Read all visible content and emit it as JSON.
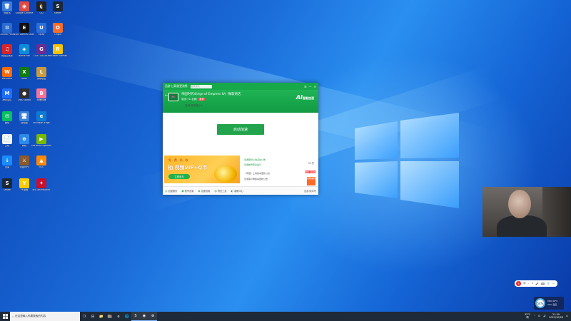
{
  "desktop": {
    "icons": [
      {
        "label": "回收站",
        "glyph": "🗑",
        "color": "#3b7dd8"
      },
      {
        "label": "Google Chrome",
        "glyph": "◉",
        "color": "#e04a3f"
      },
      {
        "label": "QQ",
        "glyph": "🐧",
        "color": "#222222"
      },
      {
        "label": "Steam",
        "glyph": "S",
        "color": "#1b2838"
      },
      {
        "label": "Control Panel",
        "glyph": "⚙",
        "color": "#2a6bd0"
      },
      {
        "label": "Epic Games Launcher",
        "glyph": "E",
        "color": "#111111"
      },
      {
        "label": "Uplay",
        "glyph": "U",
        "color": "#2a6fd6"
      },
      {
        "label": "Origin",
        "glyph": "O",
        "color": "#f56c2d"
      },
      {
        "label": "网易云音乐",
        "glyph": "♫",
        "color": "#d8232a"
      },
      {
        "label": "Battle.net",
        "glyph": "◈",
        "color": "#0d8bd8"
      },
      {
        "label": "GOG GALAXY",
        "glyph": "G",
        "color": "#6b2c91"
      },
      {
        "label": "Rockstar Games",
        "glyph": "R",
        "color": "#f6c300"
      },
      {
        "label": "WeGame",
        "glyph": "W",
        "color": "#ff6a00"
      },
      {
        "label": "Xbox",
        "glyph": "X",
        "color": "#107c10"
      },
      {
        "label": "英雄联盟",
        "glyph": "L",
        "color": "#c89b3c"
      },
      {
        "label": "腾讯会议",
        "glyph": "M",
        "color": "#1e6fff"
      },
      {
        "label": "OBS Studio",
        "glyph": "●",
        "color": "#302e31"
      },
      {
        "label": "哔哩哔哩",
        "glyph": "B",
        "color": "#fb7299"
      },
      {
        "label": "微信",
        "glyph": "✉",
        "color": "#07c160"
      },
      {
        "label": "此电脑",
        "glyph": "🖥",
        "color": "#3a82d6"
      },
      {
        "label": "Microsoft Edge",
        "glyph": "e",
        "color": "#0c7bd1"
      },
      {
        "label": "文档",
        "glyph": "📄",
        "color": "#f2f2f2"
      },
      {
        "label": "网络",
        "glyph": "⊕",
        "color": "#2e8ae6"
      },
      {
        "label": "GeForce Experience",
        "glyph": "▶",
        "color": "#76b900"
      },
      {
        "label": "迅雷",
        "glyph": "↓",
        "color": "#1a8cff"
      },
      {
        "label": "帝国时代",
        "glyph": "⚔",
        "color": "#8a5a2b"
      },
      {
        "label": "VLC",
        "glyph": "▲",
        "color": "#ff8800"
      },
      {
        "label": "Steam",
        "glyph": "S",
        "color": "#1b2838"
      },
      {
        "label": "YY语音",
        "glyph": "Y",
        "color": "#ffcc00"
      },
      {
        "label": "MSI Afterburner",
        "glyph": "✦",
        "color": "#c8102e"
      }
    ]
  },
  "app": {
    "title": "迅游 让网游更流畅",
    "search_placeholder": "搜索游戏",
    "window_controls": [
      "☰",
      "—",
      "✕"
    ],
    "back": "←",
    "game_title": "帝国时代4(Age of Empires IV) -微软商店",
    "game_sub": "加速 (711区服)",
    "game_tag": "推荐",
    "brand": "AI",
    "brand_text": "智能加速",
    "region": "亚洲(东南亚) ⊙",
    "start_button": "启动加速",
    "ad": {
      "line1": "免 · 费 · 领 · 取",
      "line2": "抽 视频VIP+Q币",
      "button": "立即参与"
    },
    "news": [
      {
        "text": "迅游限时上线活动公告",
        "style": "green"
      },
      {
        "text": "迅游帐号安全提示",
        "style": "green"
      },
      {
        "text": "《帝国》上线版本更新公告",
        "style": "gray"
      },
      {
        "text": "迅游客户端版本更新公告",
        "style": "gray"
      }
    ],
    "like": "96 赞",
    "hot": "热门活动",
    "gift": "领取福利",
    "footer": [
      {
        "icon": "◎",
        "label": "加速服务"
      },
      {
        "icon": "◉",
        "label": "帐号设置"
      },
      {
        "icon": "◈",
        "label": "加速设置"
      },
      {
        "icon": "◍",
        "label": "修复工具"
      },
      {
        "icon": "◐",
        "label": "客服中心"
      }
    ],
    "footer_right": "迅游 版本号"
  },
  "ime": {
    "logo": "S",
    "items": [
      "中",
      "·",
      "ゞ",
      "🎤",
      "⌨",
      "👕",
      "⋯"
    ]
  },
  "perf": {
    "value": "54%",
    "line1": "CPU 40°C",
    "line2": "GPU 温度"
  },
  "taskbar": {
    "search_text": "在这里输入你要搜索的内容",
    "pinned": [
      "❍",
      "⊟",
      "📁",
      "🏬",
      "e",
      "🌐",
      "S",
      "◉",
      "⊕"
    ],
    "tray_temp": "32°C",
    "tray_weather": "晴",
    "tray_time": "21:30",
    "tray_date": "2021/10/28"
  }
}
